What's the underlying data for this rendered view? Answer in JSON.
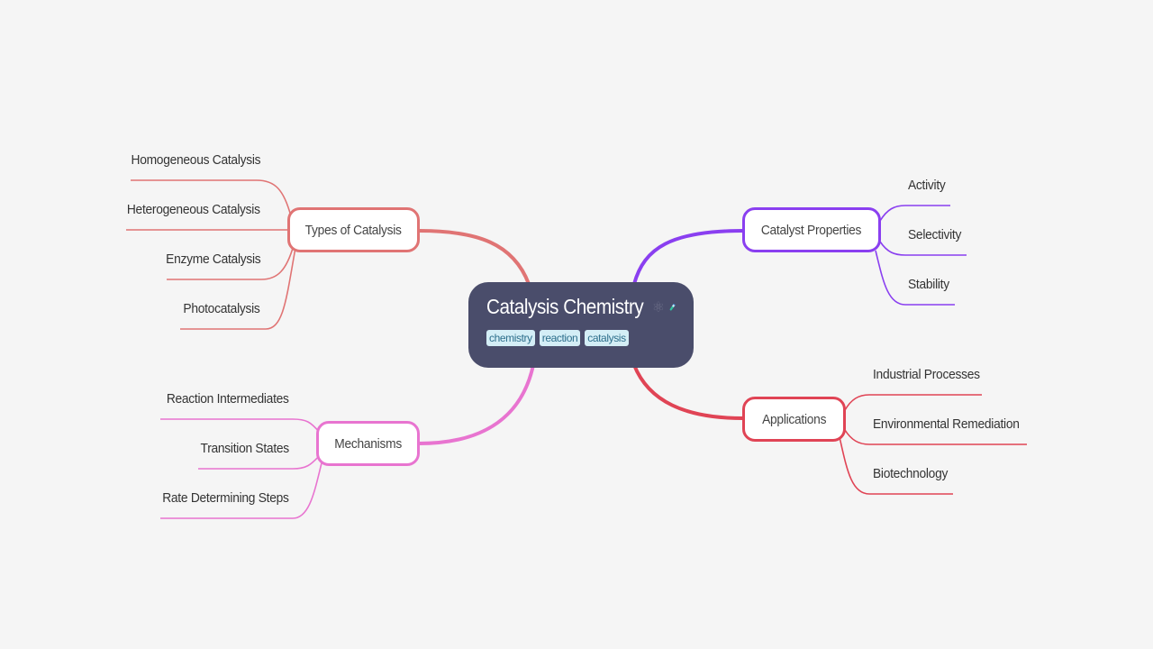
{
  "central": {
    "title": "Catalysis Chemistry",
    "icons": [
      "atom-icon",
      "test-tube-icon"
    ],
    "tags": [
      "chemistry",
      "reaction",
      "catalysis"
    ],
    "background": "#4a4d6b"
  },
  "branches": [
    {
      "id": "types",
      "label": "Types of Catalysis",
      "color": "#e07474",
      "side": "left",
      "children": [
        "Homogeneous Catalysis",
        "Heterogeneous Catalysis",
        "Enzyme Catalysis",
        "Photocatalysis"
      ]
    },
    {
      "id": "mechanisms",
      "label": "Mechanisms",
      "color": "#e874d0",
      "side": "left",
      "children": [
        "Reaction Intermediates",
        "Transition States",
        "Rate Determining Steps"
      ]
    },
    {
      "id": "properties",
      "label": "Catalyst Properties",
      "color": "#8a3ff0",
      "side": "right",
      "children": [
        "Activity",
        "Selectivity",
        "Stability"
      ]
    },
    {
      "id": "applications",
      "label": "Applications",
      "color": "#e04455",
      "side": "right",
      "children": [
        "Industrial Processes",
        "Environmental Remediation",
        "Biotechnology"
      ]
    }
  ]
}
